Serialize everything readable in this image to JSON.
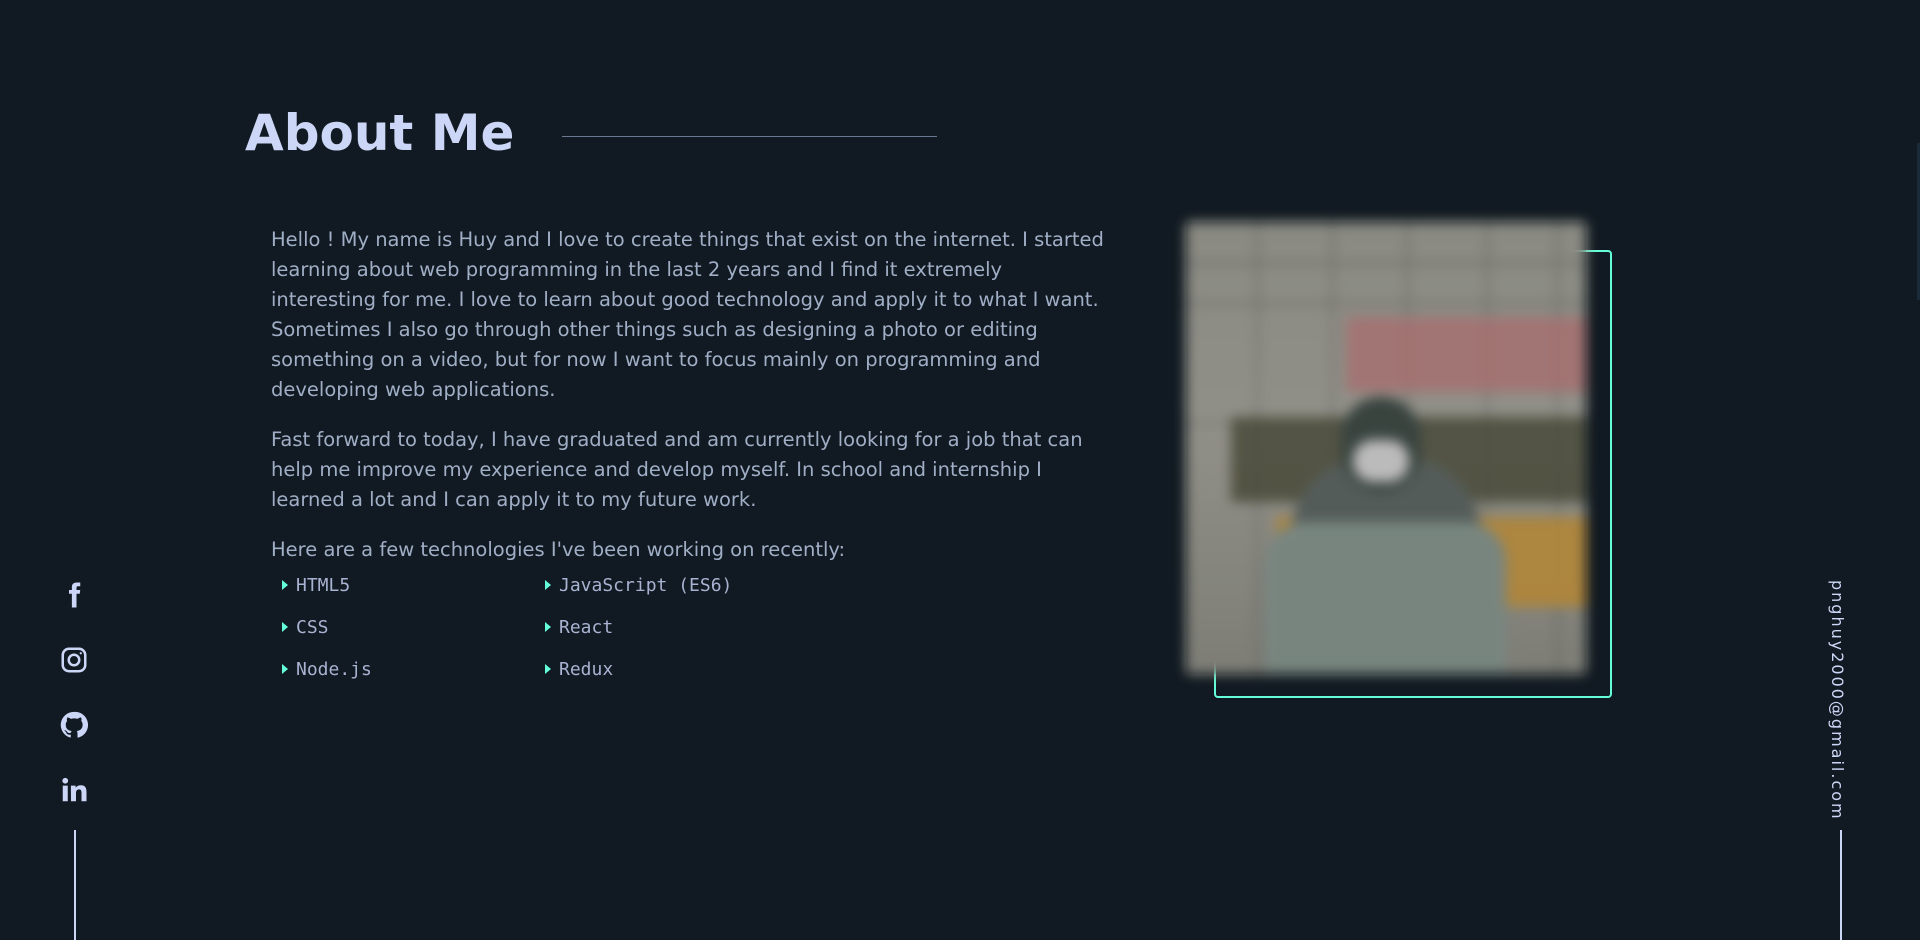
{
  "about": {
    "title": "About Me",
    "paragraphs": [
      "Hello ! My name is Huy and I love to create things that exist on the internet. I started learning about web programming in the last 2 years and I find it extremely interesting for me. I love to learn about good technology and apply it to what I want. Sometimes I also go through other things such as designing a photo or editing something on a video, but for now I want to focus mainly on programming and developing web applications.",
      "Fast forward to today, I have graduated and am currently looking for a job that can help me improve my experience and develop myself. In school and internship I learned a lot and I can apply it to my future work.",
      "Here are a few technologies I've been working on recently:"
    ],
    "technologies": [
      "HTML5",
      "JavaScript (ES6)",
      "CSS",
      "React",
      "Node.js",
      "Redux"
    ]
  },
  "social": {
    "icons": [
      "facebook-icon",
      "instagram-icon",
      "github-icon",
      "linkedin-icon"
    ]
  },
  "email": {
    "address": "pnghuy2000@gmail.com"
  },
  "colors": {
    "background": "#111a22",
    "accent": "#64ffda",
    "heading": "#ccd6f6",
    "body_text": "#a0aec6",
    "list_text": "#a8b2d1"
  }
}
